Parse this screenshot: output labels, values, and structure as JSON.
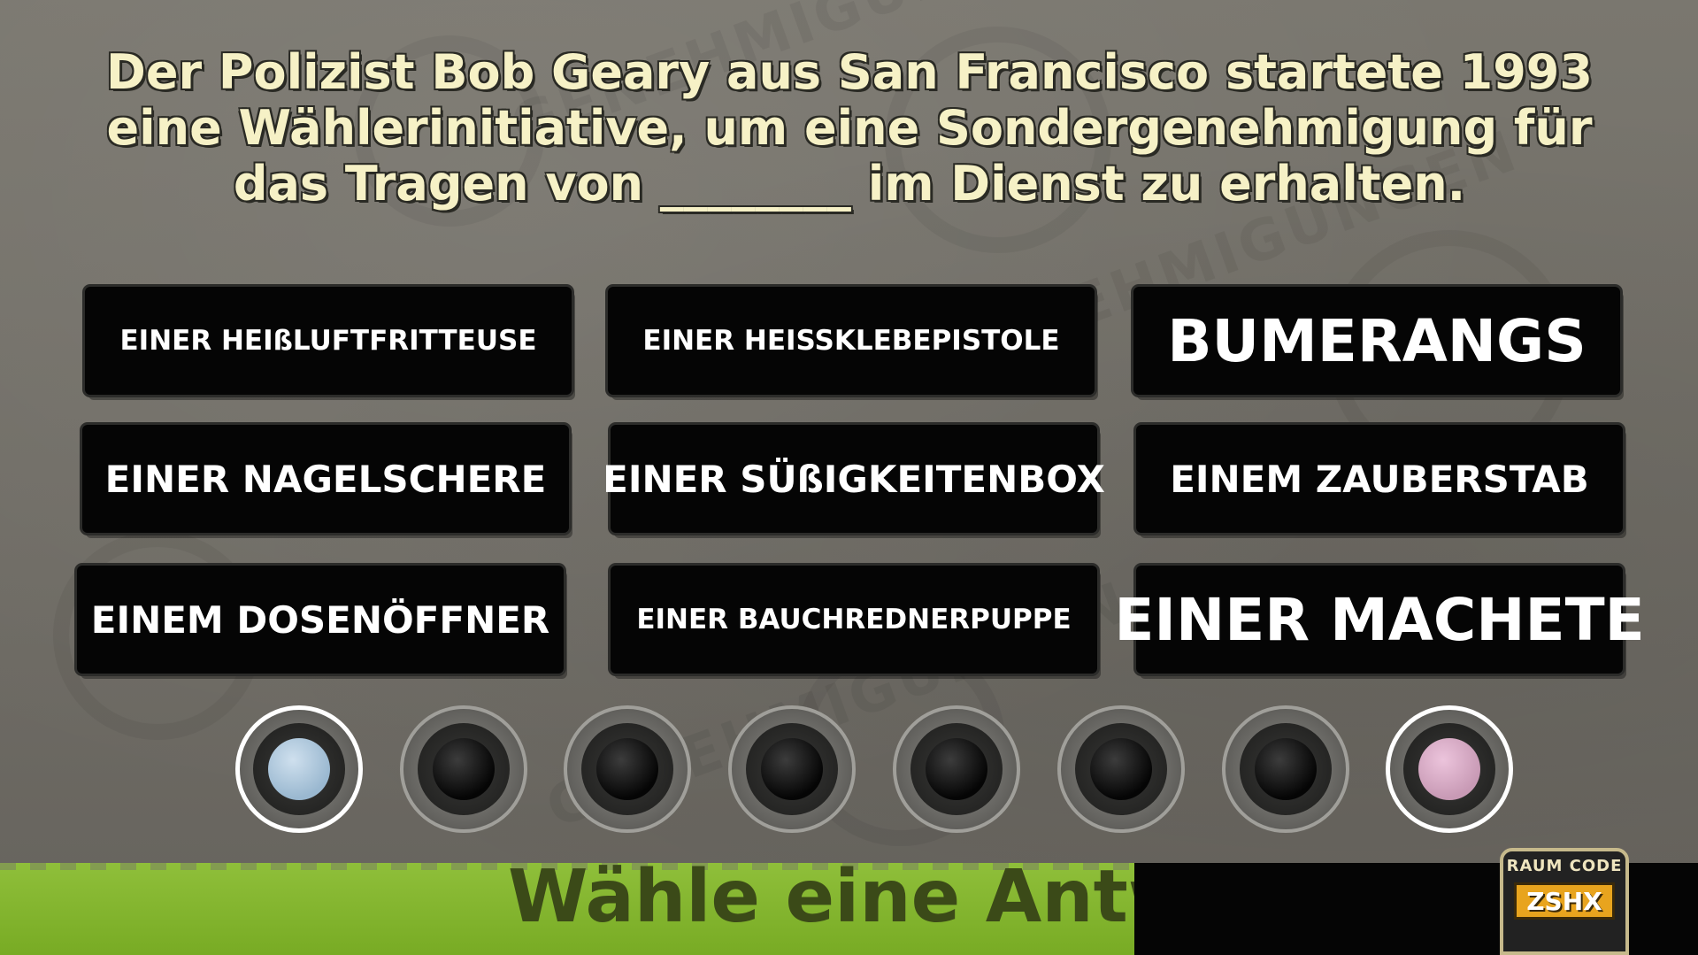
{
  "question": {
    "line1": "Der Polizist Bob Geary aus San Francisco startete 1993",
    "line2": "eine Wählerinitiative, um eine Sondergenehmigung für",
    "line3": "das Tragen von ________ im Dienst zu erhalten."
  },
  "answers": [
    "EINER HEIßLUFTFRITTEUSE",
    "EINER HEISSKLEBEPISTOLE",
    "BUMERANGS",
    "EINER NAGELSCHERE",
    "EINER SÜßIGKEITENBOX",
    "EINEM ZAUBERSTAB",
    "EINEM DOSENÖFFNER",
    "EINER BAUCHREDNERPUPPE",
    "EINER MACHETE"
  ],
  "players": [
    {
      "color": "#a9c4da",
      "state": "active"
    },
    {
      "color": "#000000",
      "state": "inactive"
    },
    {
      "color": "#000000",
      "state": "inactive"
    },
    {
      "color": "#000000",
      "state": "inactive"
    },
    {
      "color": "#000000",
      "state": "inactive"
    },
    {
      "color": "#000000",
      "state": "inactive"
    },
    {
      "color": "#000000",
      "state": "inactive"
    },
    {
      "color": "#d9a9c6",
      "state": "active"
    }
  ],
  "footer": {
    "prompt": "Wähle eine Antw",
    "room_label": "RAUM CODE",
    "room_code": "ZSHX"
  },
  "background_words": [
    "GENEHMIGUNGEN",
    "GENEHMIGUNGEN",
    "GENEHMIGUNGEN"
  ],
  "colors": {
    "question_text": "#f6f1c6",
    "answer_bg": "#050505",
    "footer_green": "#8fbf3a",
    "room_code_bg": "#e8a41e"
  }
}
